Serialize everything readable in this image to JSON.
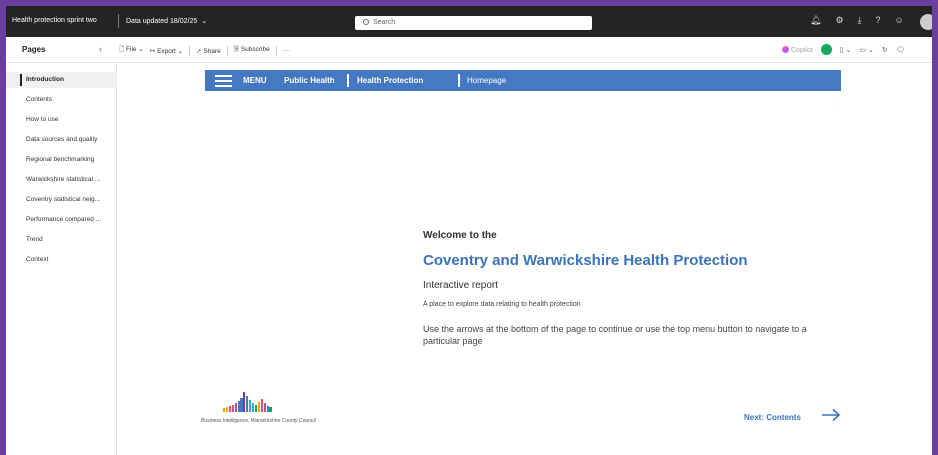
{
  "titlebar": {
    "report_title": "Health protection sprint two",
    "data_updated": "Data updated 18/02/25",
    "search_placeholder": "Search"
  },
  "toolbar": {
    "pages_label": "Pages",
    "file_label": "File",
    "export_label": "Export",
    "share_label": "Share",
    "subscribe_label": "Subscribe",
    "more_label": "···",
    "copilot_label": "Copilot"
  },
  "sidebar": {
    "items": [
      {
        "label": "Introduction"
      },
      {
        "label": "Contents"
      },
      {
        "label": "How to use"
      },
      {
        "label": "Data sources and quality"
      },
      {
        "label": "Regional benchmarking"
      },
      {
        "label": "Warwickshire statistical ..."
      },
      {
        "label": "Coventry statistical neig..."
      },
      {
        "label": "Performance compared ..."
      },
      {
        "label": "Trend"
      },
      {
        "label": "Context"
      }
    ],
    "active_index": 0
  },
  "report": {
    "menu_label": "MENU",
    "breadcrumb": {
      "public_health": "Public Health",
      "health_protection": "Health Protection",
      "homepage": "Homepage"
    },
    "welcome": "Welcome to the",
    "title": "Coventry and Warwickshire Health Protection",
    "subtitle": "Interactive report",
    "description": "A place to explore data relating to health protection",
    "instructions": "Use the arrows at the bottom of the page to continue or use the top menu button to navigate to a particular page",
    "logo_caption": "Business Intelligence, Warwickshire County Council",
    "next_label": "Next: Contents"
  },
  "colors": {
    "window_border": "#6b3fa0",
    "titlebar_bg": "#252423",
    "menubar_bg": "#4478c0",
    "title_blue": "#3b73b9",
    "avatar_green": "#13a85c"
  }
}
